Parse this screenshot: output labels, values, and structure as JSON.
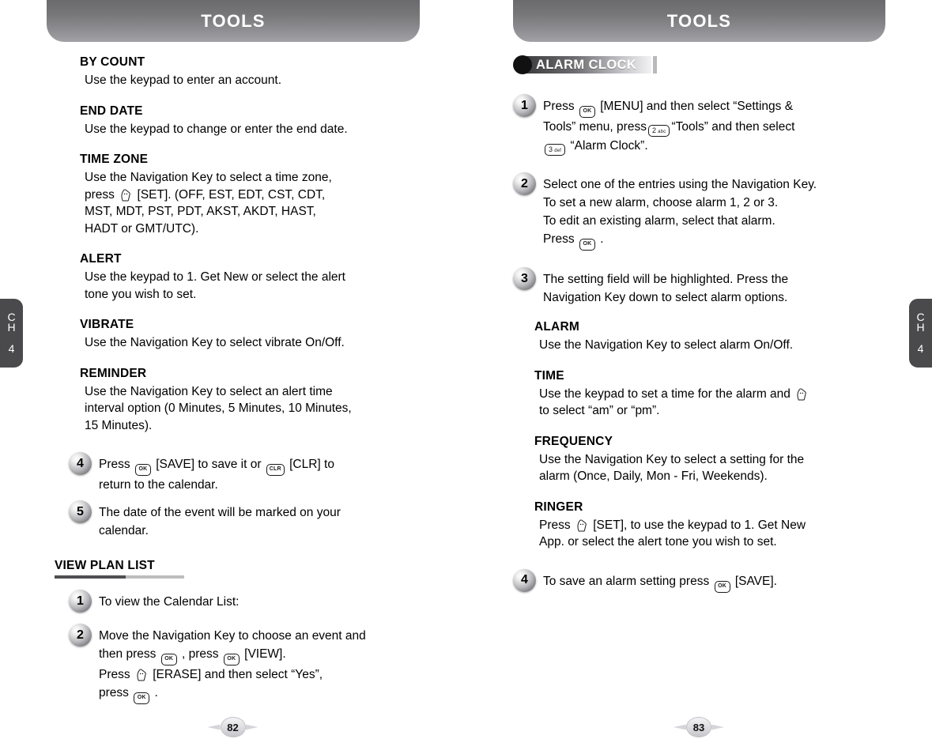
{
  "left_page": {
    "banner_title": "TOOLS",
    "page_number": "82",
    "side_tab": {
      "ch": "C\nH",
      "chapter": "4"
    },
    "sections": [
      {
        "title": "BY COUNT",
        "body": "Use the keypad to enter an account."
      },
      {
        "title": "END DATE",
        "body": "Use the keypad to change or enter the end date."
      },
      {
        "title": "TIME ZONE",
        "body_pre": "Use the Navigation Key to select a time zone,\npress ",
        "body_post": " [SET]. (OFF, EST, EDT, CST, CDT,\nMST, MDT, PST, PDT, AKST, AKDT, HAST,\nHADT or GMT/UTC)."
      },
      {
        "title": "ALERT",
        "body": "Use the keypad to 1. Get New or select the alert\ntone you wish to set."
      },
      {
        "title": "VIBRATE",
        "body": "Use the Navigation Key to select vibrate On/Off."
      },
      {
        "title": "REMINDER",
        "body": "Use the Navigation Key to select an alert time\ninterval option (0 Minutes, 5 Minutes, 10 Minutes,\n15 Minutes)."
      }
    ],
    "steps": [
      {
        "num": "4",
        "t1": "Press ",
        "t2": " [SAVE] to save it or ",
        "t3": " [CLR] to\nreturn to the calendar."
      },
      {
        "num": "5",
        "t1": "The date of the event will be marked on your\ncalendar."
      }
    ],
    "group": {
      "title": "VIEW PLAN LIST",
      "steps": [
        {
          "num": "1",
          "t1": "To view the Calendar List:"
        },
        {
          "num": "2",
          "t1": "Move the Navigation Key to choose an event and\nthen press ",
          "t2": " , press ",
          "t3": " [VIEW].\nPress ",
          "t4": " [ERASE] and then select “Yes”,\npress ",
          "t5": " ."
        }
      ]
    }
  },
  "right_page": {
    "banner_title": "TOOLS",
    "page_number": "83",
    "side_tab": {
      "ch": "C\nH",
      "chapter": "4"
    },
    "band_label": "ALARM CLOCK",
    "steps": [
      {
        "num": "1",
        "t1": "Press ",
        "t2": " [MENU] and then select “Settings &\nTools” menu, press",
        "t3": "“Tools” and then select\n",
        "t4": " “Alarm Clock”."
      },
      {
        "num": "2",
        "t1": "Select one of the entries using the Navigation Key.\nTo set a new alarm, choose alarm 1, 2 or 3.\nTo edit an existing alarm, select that alarm.\nPress ",
        "t2": " ."
      },
      {
        "num": "3",
        "t1": "The setting field will be highlighted. Press the\nNavigation Key down to select alarm options."
      }
    ],
    "sections": [
      {
        "title": "ALARM",
        "body": "Use the Navigation Key to select alarm On/Off."
      },
      {
        "title": "TIME",
        "body_pre": "Use the keypad to set a time for the alarm and ",
        "body_post": "\nto select “am” or “pm”."
      },
      {
        "title": "FREQUENCY",
        "body": "Use the Navigation Key to select a setting for the\nalarm (Once, Daily, Mon - Fri, Weekends)."
      },
      {
        "title": "RINGER",
        "body_pre": "Press ",
        "body_post": " [SET], to use the keypad to 1. Get New\nApp. or select the alert tone you wish to set."
      }
    ],
    "final_step": {
      "num": "4",
      "t1": "To save an alarm setting press ",
      "t2": " [SAVE]."
    }
  },
  "keys": {
    "ok": "OK",
    "clr": "CLR",
    "two_digit": "2",
    "two_letters": "abc",
    "three_digit": "3",
    "three_letters": "def"
  },
  "colors": {
    "banner_dark": "#6a6a6e",
    "banner_light": "#a2a2a6",
    "tab_bg": "#4a4a4c",
    "band_dark": "#3c3c3e",
    "rule_dark": "#4f4f51",
    "rule_light": "#bdbdbd",
    "text": "#000000"
  }
}
